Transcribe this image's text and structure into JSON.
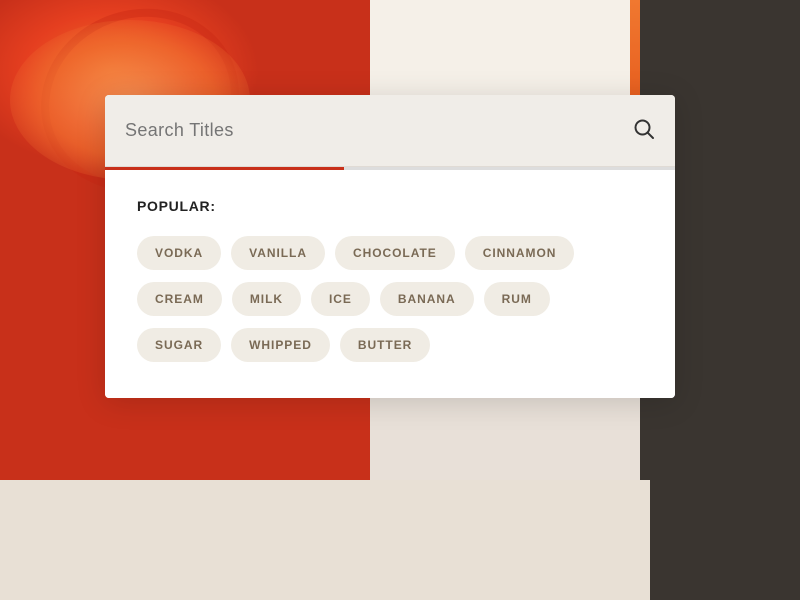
{
  "background": {
    "description": "Painted food photography background"
  },
  "search_bar": {
    "placeholder": "Search Titles",
    "value": ""
  },
  "popular_label": "POPULAR:",
  "tags": [
    {
      "label": "VODKA"
    },
    {
      "label": "VANILLA"
    },
    {
      "label": "CHOCOLATE"
    },
    {
      "label": "CINNAMON"
    },
    {
      "label": "CREAM"
    },
    {
      "label": "MILK"
    },
    {
      "label": "ICE"
    },
    {
      "label": "BANANA"
    },
    {
      "label": "RUM"
    },
    {
      "label": "SUGAR"
    },
    {
      "label": "WHIPPED"
    },
    {
      "label": "BUTTER"
    }
  ],
  "progress": {
    "filled_pct": 42
  }
}
